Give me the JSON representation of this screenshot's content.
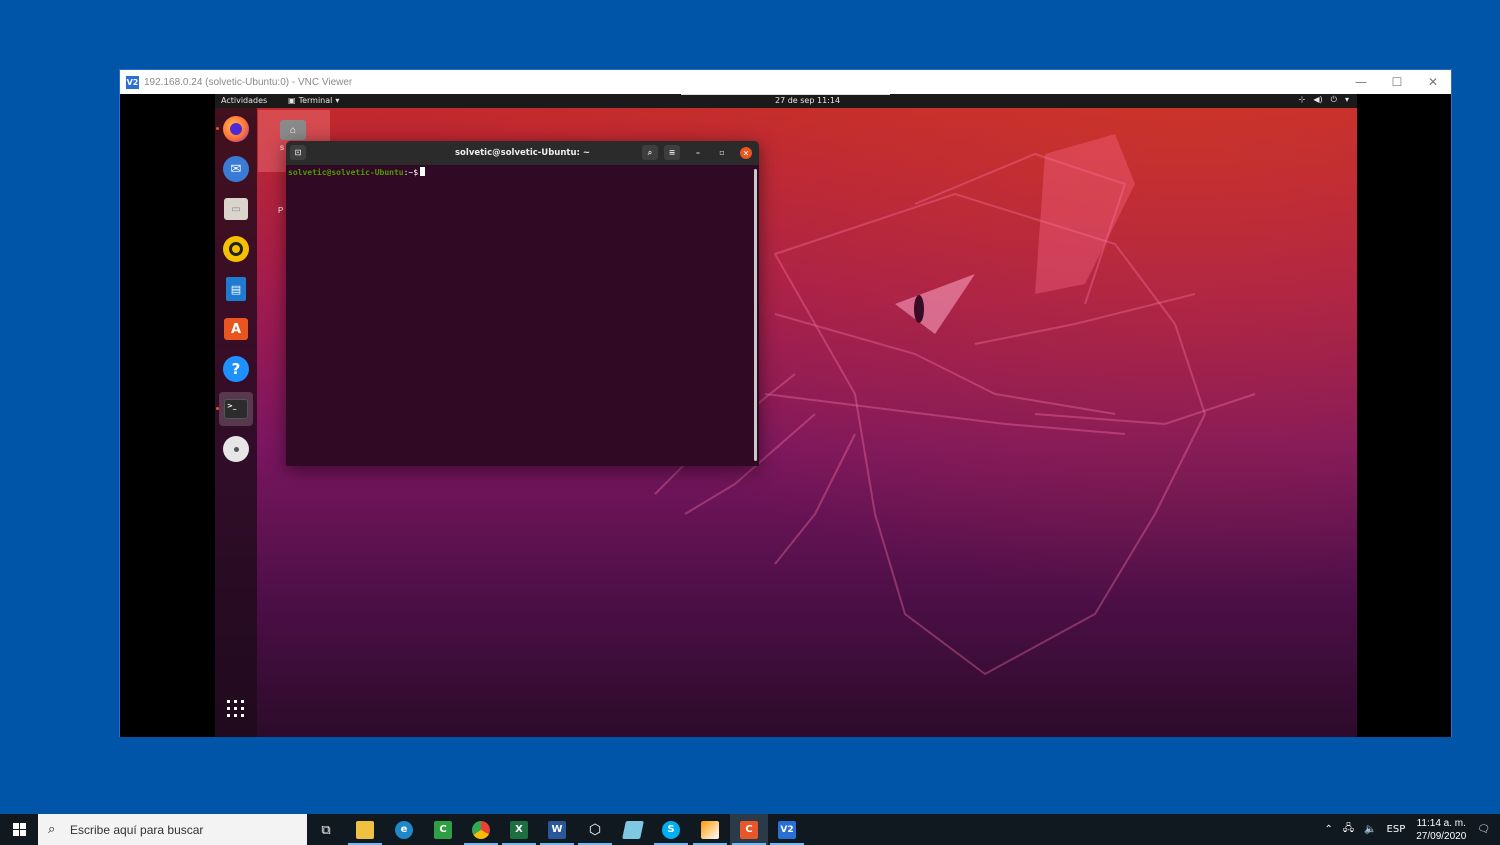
{
  "vnc": {
    "logo": "V2",
    "title": "192.168.0.24 (solvetic-Ubuntu:0) - VNC Viewer",
    "controls": {
      "minimize": "—",
      "maximize": "☐",
      "close": "✕"
    }
  },
  "ubuntu": {
    "topbar": {
      "activities": "Actividades",
      "app_menu": "Terminal",
      "clock": "27 de sep  11:14"
    },
    "desktop": {
      "home_label_partial": "s",
      "second_label_partial": "P"
    },
    "dock": [
      {
        "name": "firefox-icon",
        "glyph": "🦊",
        "color": "#ff7139"
      },
      {
        "name": "thunderbird-icon",
        "glyph": "✉",
        "color": "#3a7bd5"
      },
      {
        "name": "files-icon",
        "glyph": "▭",
        "color": "#d9d5cc"
      },
      {
        "name": "rhythmbox-icon",
        "glyph": "◉",
        "color": "#f5c000"
      },
      {
        "name": "libreoffice-writer-icon",
        "glyph": "▤",
        "color": "#1f7bd1"
      },
      {
        "name": "software-icon",
        "glyph": "A",
        "color": "#e95420"
      },
      {
        "name": "help-icon",
        "glyph": "?",
        "color": "#1e90ff"
      },
      {
        "name": "terminal-icon",
        "glyph": ">_",
        "color": "#2c2c2c"
      },
      {
        "name": "dvd-icon",
        "glyph": "◎",
        "color": "#e6e6e6"
      }
    ],
    "apps_grid": "⋮⋮⋮",
    "terminal": {
      "title": "solvetic@solvetic-Ubuntu: ~",
      "prompt_user": "solvetic@solvetic-Ubuntu",
      "prompt_rest": ":~$"
    }
  },
  "taskbar": {
    "search_placeholder": "Escribe aquí para buscar",
    "language": "ESP",
    "time": "11:14 a. m.",
    "date": "27/09/2020"
  },
  "colors": {
    "desktop_bg": "#0055a8",
    "ubuntu_orange": "#e95420",
    "terminal_bg": "#300a24",
    "prompt_green": "#4e9a06"
  }
}
